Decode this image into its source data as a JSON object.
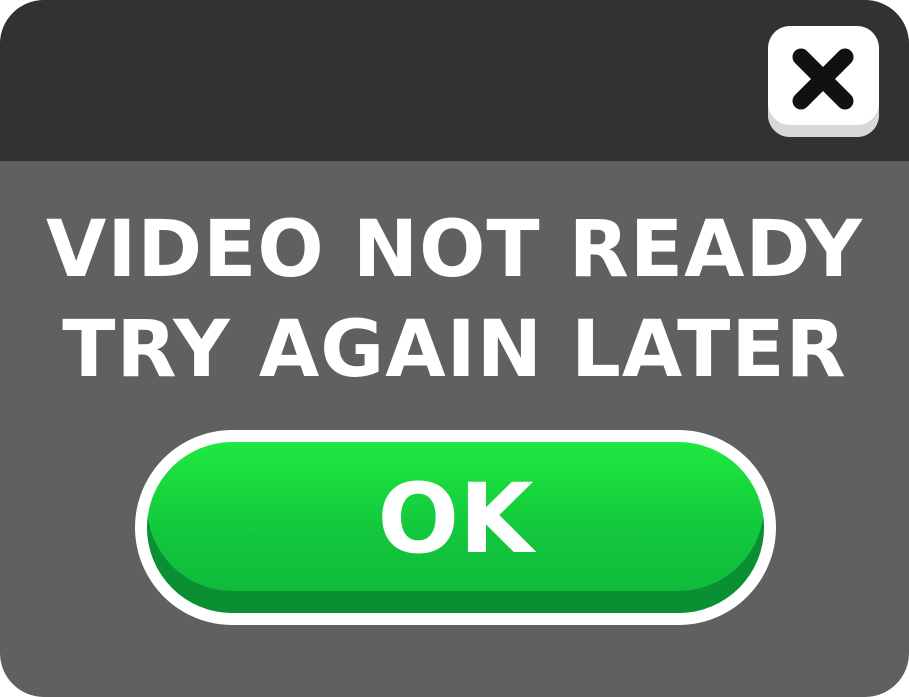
{
  "dialog": {
    "message_line1": "VIDEO NOT READY",
    "message_line2": "TRY AGAIN LATER",
    "close_icon": "close-x-icon",
    "ok_label": "OK"
  },
  "colors": {
    "titlebar": "#323232",
    "body": "#606060",
    "ok_button": "#16d43d",
    "ok_button_shadow": "#0a8f32",
    "text": "#ffffff"
  }
}
